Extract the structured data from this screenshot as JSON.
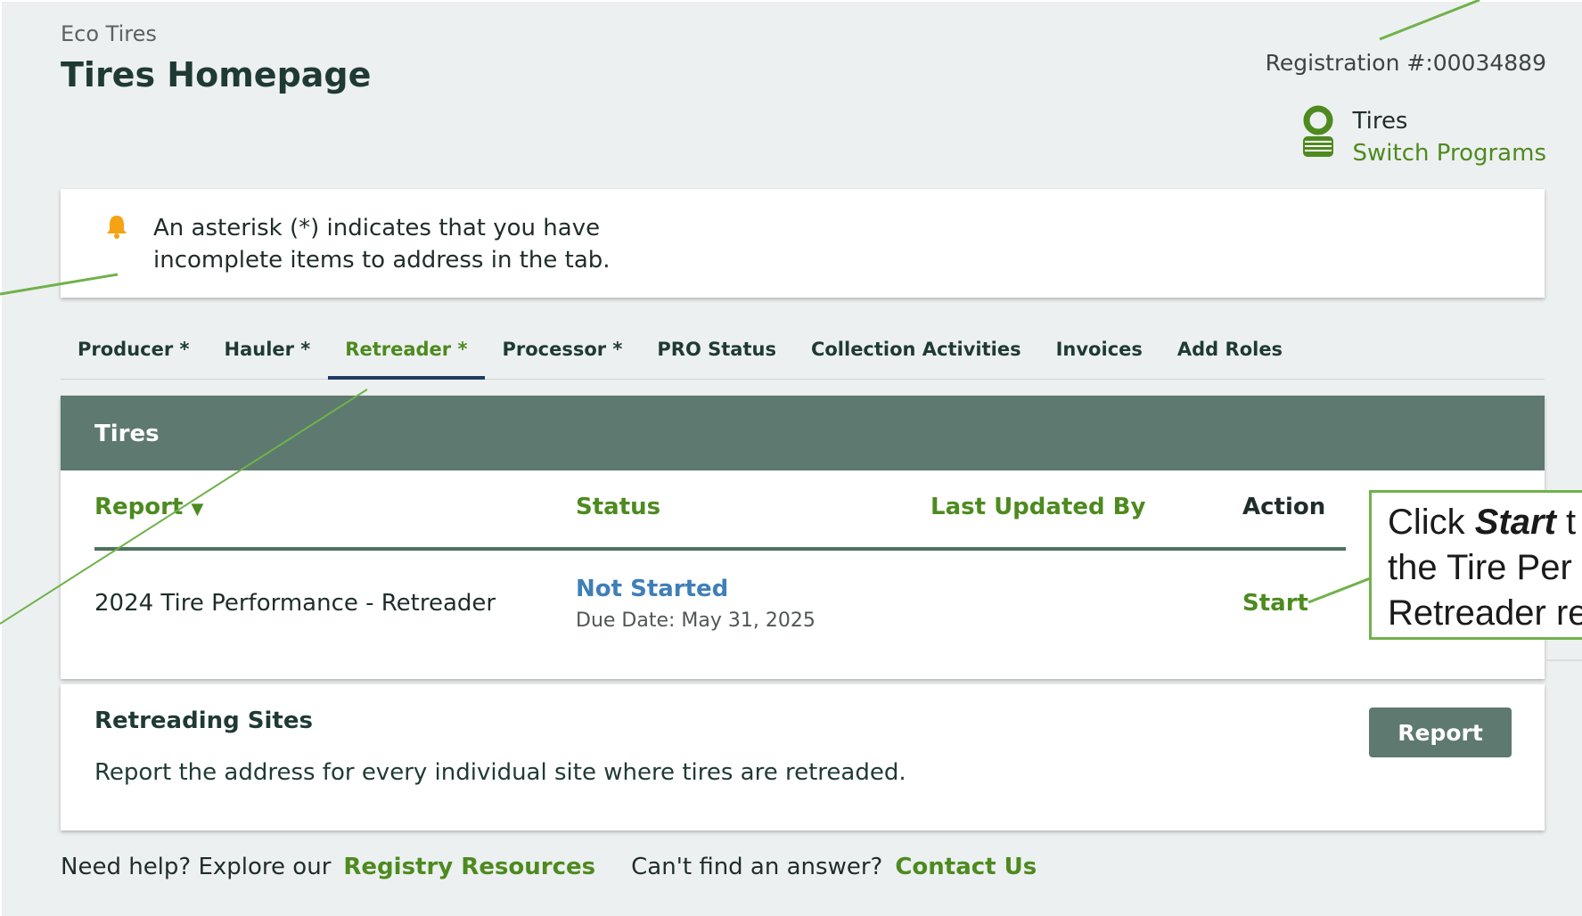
{
  "header": {
    "org_name": "Eco Tires",
    "page_title": "Tires Homepage",
    "registration": "Registration #:00034889",
    "program_name": "Tires",
    "switch_programs_label": "Switch Programs"
  },
  "alert": {
    "message": "An asterisk (*) indicates that you have incomplete items to address in the tab."
  },
  "tabs": [
    {
      "label": "Producer *"
    },
    {
      "label": "Hauler *"
    },
    {
      "label": "Retreader *",
      "active": true
    },
    {
      "label": "Processor *"
    },
    {
      "label": "PRO Status"
    },
    {
      "label": "Collection Activities"
    },
    {
      "label": "Invoices"
    },
    {
      "label": "Add Roles"
    }
  ],
  "reports_card": {
    "title": "Tires",
    "columns": {
      "report": "Report",
      "status": "Status",
      "last_updated_by": "Last Updated By",
      "action": "Action"
    },
    "rows": [
      {
        "report": "2024 Tire Performance - Retreader",
        "status": "Not Started",
        "due_date": "Due Date: May 31, 2025",
        "last_updated_by": "",
        "action": "Start"
      }
    ]
  },
  "sites_card": {
    "title": "Retreading Sites",
    "description": "Report the address for every individual site where tires are retreaded.",
    "button_label": "Report"
  },
  "footer": {
    "help_prefix": "Need help?  Explore our",
    "resources_link": "Registry Resources",
    "answer_prefix": "Can't find an answer?",
    "contact_link": "Contact Us"
  },
  "annotation": {
    "line1_pre": "Click ",
    "line1_bold": "Start",
    "line1_post": " t",
    "line2": "the Tire Per",
    "line3": "Retreader  re"
  },
  "colors": {
    "accent_green": "#4d8a1f",
    "header_teal": "#5e7970",
    "status_blue": "#3f7fb8",
    "callout_green": "#6fb24a",
    "bell_orange": "#f5a214"
  },
  "icons": {
    "bell": "bell-icon",
    "tire": "tire-icon",
    "sort": "sort-arrow-icon"
  }
}
